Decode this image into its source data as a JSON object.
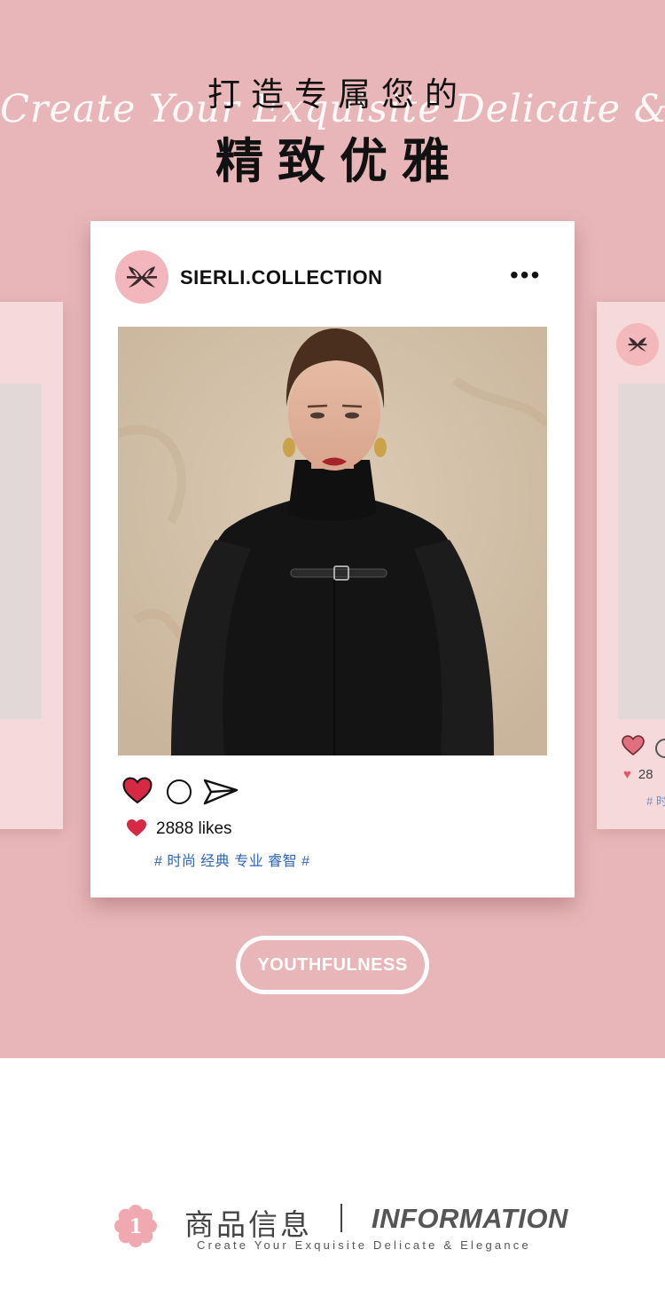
{
  "banner": {
    "title_top": "打造专属您的",
    "title_main": "精致优雅",
    "script_tagline": "Create Your Exquisite Delicate & Elegance"
  },
  "post": {
    "handle": "SIERLI.COLLECTION",
    "more_icon": "more-horizontal-icon",
    "likes": "2888 likes",
    "tags": "# 时尚 经典 专业 睿智 #"
  },
  "side_card": {
    "likes_partial": "28",
    "tags_partial": "# 时"
  },
  "pill": {
    "label": "YOUTHFULNESS"
  },
  "info": {
    "number": "1",
    "cn_label": "商品信息",
    "en_label": "INFORMATION",
    "sub": "Create Your Exquisite Delicate & Elegance"
  },
  "colors": {
    "background_pink": "#e8b6b8",
    "heart_red": "#d62a44",
    "tag_blue": "#2d64b4",
    "logo_pink": "#f3b6bc"
  }
}
